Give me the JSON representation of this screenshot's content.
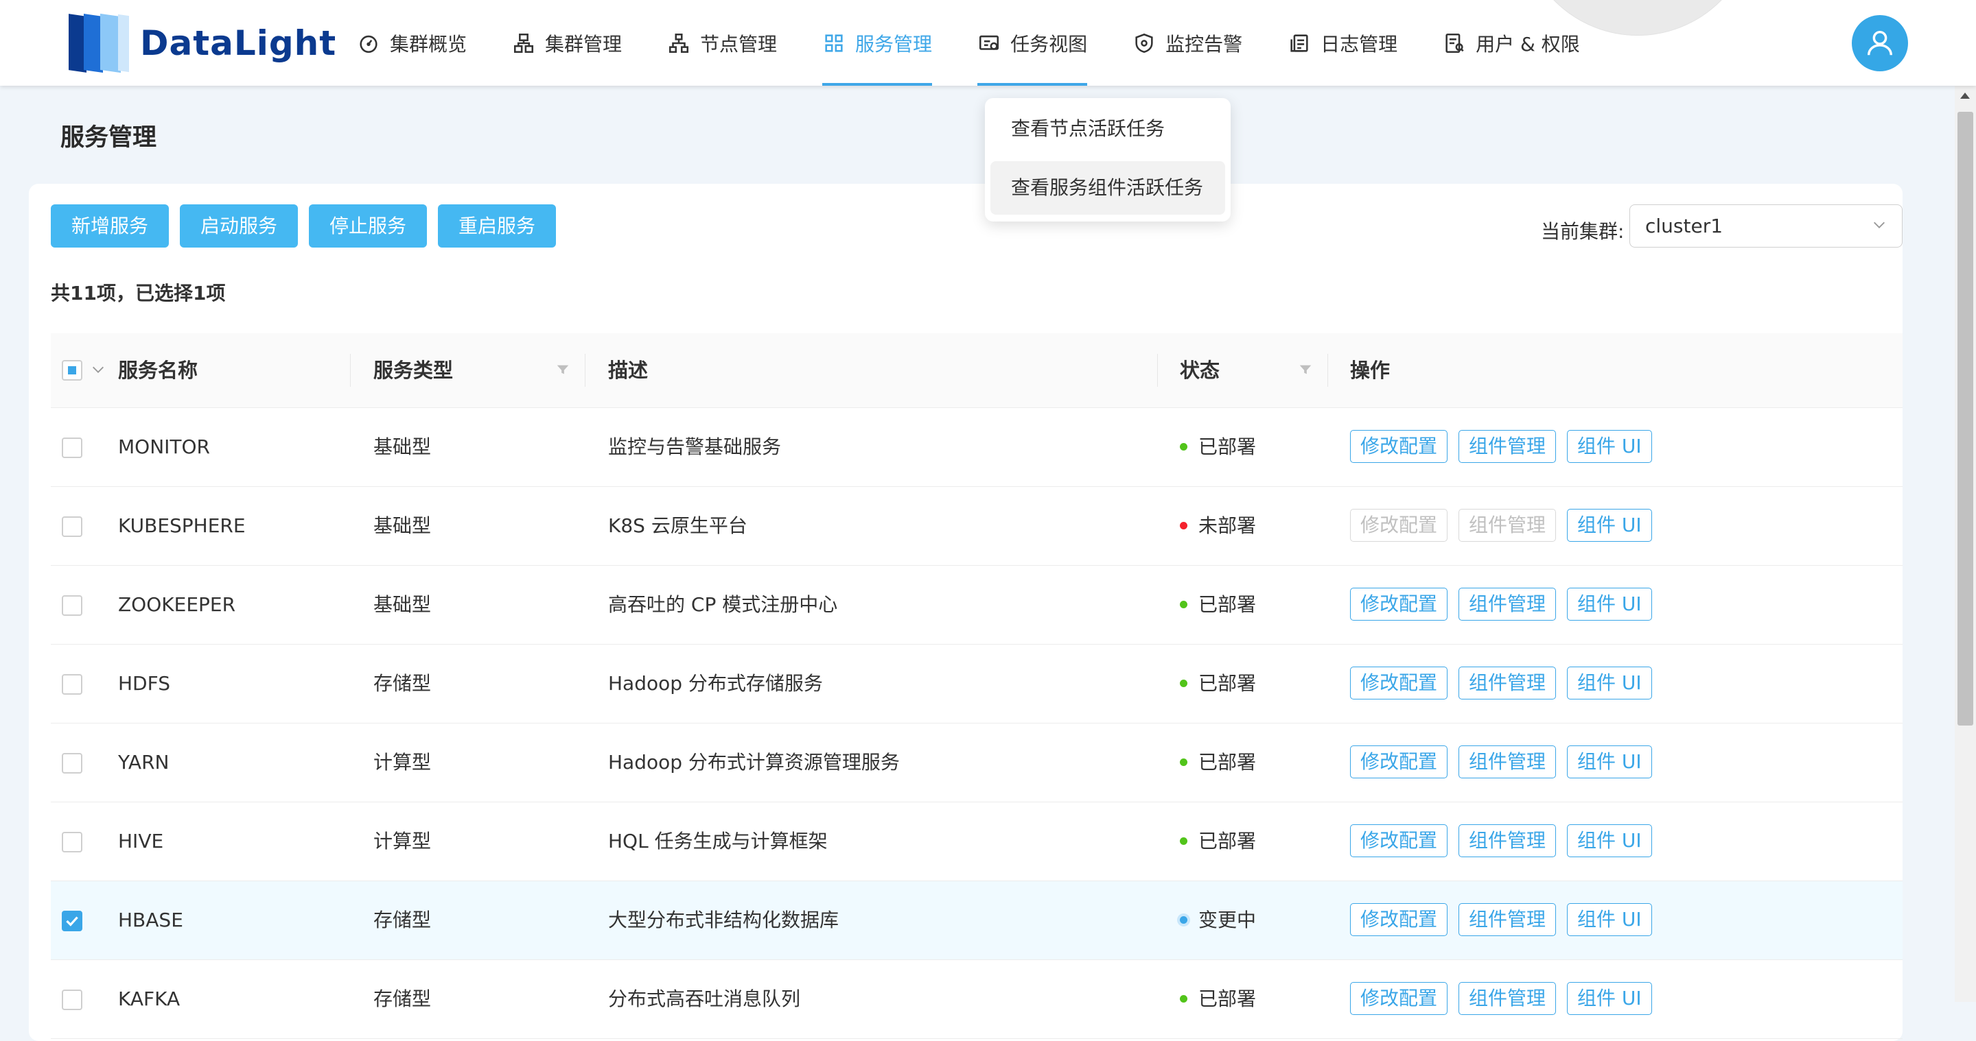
{
  "app": {
    "name": "DataLight"
  },
  "nav": {
    "items": [
      {
        "label": "集群概览",
        "icon": "dashboard-icon"
      },
      {
        "label": "集群管理",
        "icon": "cluster-icon"
      },
      {
        "label": "节点管理",
        "icon": "node-tree-icon"
      },
      {
        "label": "服务管理",
        "icon": "grid-icon",
        "active": true
      },
      {
        "label": "任务视图",
        "icon": "task-view-icon",
        "open": true
      },
      {
        "label": "监控告警",
        "icon": "shield-icon"
      },
      {
        "label": "日志管理",
        "icon": "log-icon"
      },
      {
        "label": "用户 & 权限",
        "icon": "user-permission-icon"
      }
    ]
  },
  "dropdown": {
    "items": [
      "查看节点活跃任务",
      "查看服务组件活跃任务"
    ]
  },
  "page": {
    "title": "服务管理"
  },
  "toolbar": {
    "add": "新增服务",
    "start": "启动服务",
    "stop": "停止服务",
    "restart": "重启服务"
  },
  "cluster": {
    "label": "当前集群:",
    "value": "cluster1"
  },
  "summary": "共11项，已选择1项",
  "table": {
    "headers": {
      "name": "服务名称",
      "type": "服务类型",
      "desc": "描述",
      "status": "状态",
      "ops": "操作"
    },
    "op_labels": {
      "config": "修改配置",
      "components": "组件管理",
      "ui": "组件 UI"
    },
    "rows": [
      {
        "name": "MONITOR",
        "type": "基础型",
        "desc": "监控与告警基础服务",
        "status": "已部署",
        "status_color": "green",
        "checked": false,
        "ops_disabled": false
      },
      {
        "name": "KUBESPHERE",
        "type": "基础型",
        "desc": "K8S 云原生平台",
        "status": "未部署",
        "status_color": "red",
        "checked": false,
        "ops_disabled": true
      },
      {
        "name": "ZOOKEEPER",
        "type": "基础型",
        "desc": "高吞吐的 CP 模式注册中心",
        "status": "已部署",
        "status_color": "green",
        "checked": false,
        "ops_disabled": false
      },
      {
        "name": "HDFS",
        "type": "存储型",
        "desc": "Hadoop 分布式存储服务",
        "status": "已部署",
        "status_color": "green",
        "checked": false,
        "ops_disabled": false
      },
      {
        "name": "YARN",
        "type": "计算型",
        "desc": "Hadoop 分布式计算资源管理服务",
        "status": "已部署",
        "status_color": "green",
        "checked": false,
        "ops_disabled": false
      },
      {
        "name": "HIVE",
        "type": "计算型",
        "desc": "HQL 任务生成与计算框架",
        "status": "已部署",
        "status_color": "green",
        "checked": false,
        "ops_disabled": false
      },
      {
        "name": "HBASE",
        "type": "存储型",
        "desc": "大型分布式非结构化数据库",
        "status": "变更中",
        "status_color": "blue",
        "checked": true,
        "ops_disabled": false
      },
      {
        "name": "KAFKA",
        "type": "存储型",
        "desc": "分布式高吞吐消息队列",
        "status": "已部署",
        "status_color": "green",
        "checked": false,
        "ops_disabled": false
      }
    ]
  },
  "colors": {
    "accent": "#3aa6e8",
    "button": "#45b8f2",
    "brand": "#0b3a8f"
  }
}
